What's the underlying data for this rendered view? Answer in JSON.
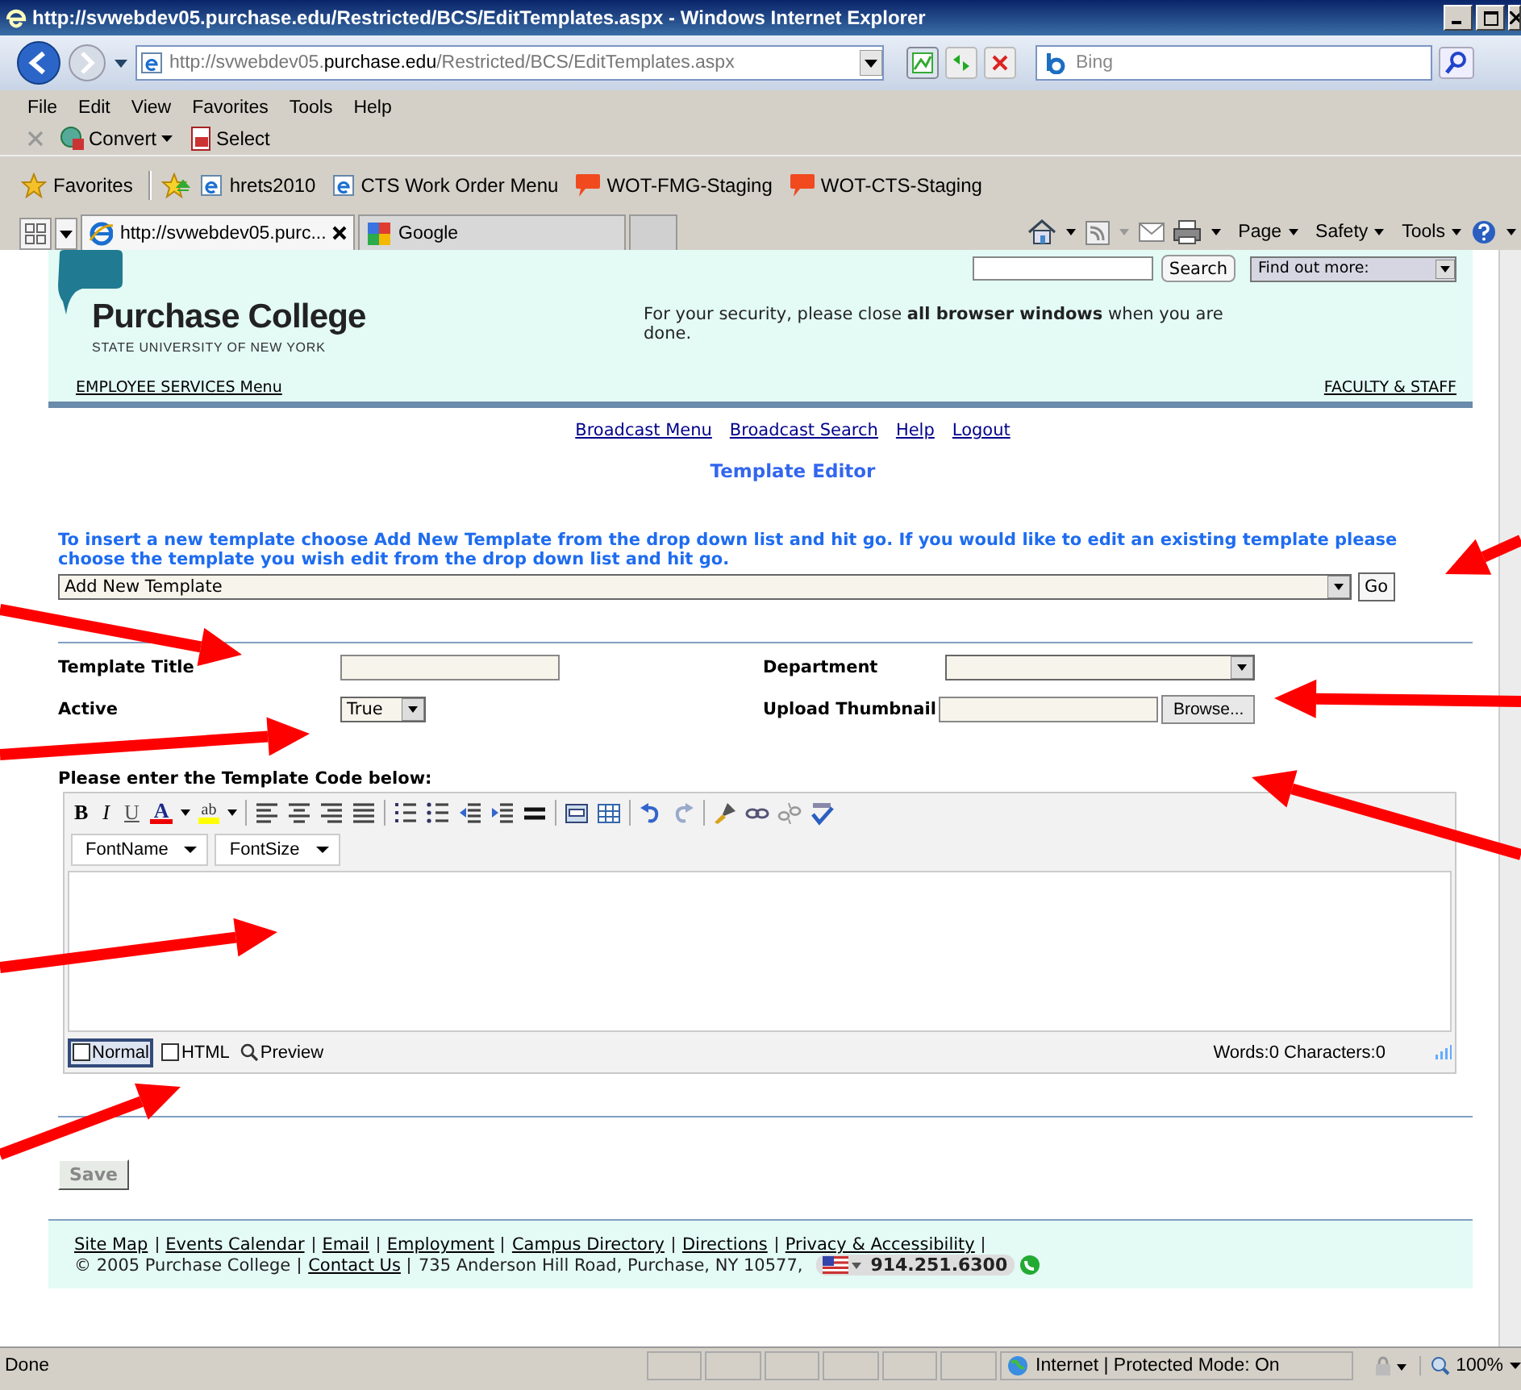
{
  "window": {
    "title": "http://svwebdev05.purchase.edu/Restricted/BCS/EditTemplates.aspx - Windows Internet Explorer"
  },
  "address_bar": {
    "url_start": "http://svwebdev05.",
    "url_domain": "purchase.edu",
    "url_end": "/Restricted/BCS/EditTemplates.aspx",
    "search_placeholder": "Bing"
  },
  "menu": [
    "File",
    "Edit",
    "View",
    "Favorites",
    "Tools",
    "Help"
  ],
  "command_bar": [
    "Convert",
    "Select"
  ],
  "favorites": {
    "label": "Favorites",
    "items": [
      {
        "label": "hrets2010",
        "kind": "page"
      },
      {
        "label": "CTS Work Order Menu",
        "kind": "page"
      },
      {
        "label": "WOT-FMG-Staging",
        "kind": "feed"
      },
      {
        "label": "WOT-CTS-Staging",
        "kind": "feed"
      }
    ]
  },
  "tabs": [
    {
      "label": "http://svwebdev05.purc...",
      "selected": true
    },
    {
      "label": "Google",
      "selected": false
    }
  ],
  "tab_tools": [
    "Page",
    "Safety",
    "Tools"
  ],
  "header": {
    "college": "Purchase College",
    "subtitle": "STATE UNIVERSITY OF NEW YORK",
    "search_button": "Search",
    "find_select": "Find out more:",
    "notice": "For your security, please close **all browser windows** when you are done.",
    "left_link": "EMPLOYEE SERVICES Menu",
    "right_link": "FACULTY & STAFF"
  },
  "nav": [
    "Broadcast Menu",
    "Broadcast Search",
    "Help",
    "Logout"
  ],
  "page_title": "Template Editor",
  "instructions": "To insert a new template choose Add New Template from the drop down list and hit go. If you would like to edit an existing template please choose the template you wish edit from the drop down list and hit go.",
  "template_select": {
    "value": "Add New Template",
    "button": "Go"
  },
  "fields": {
    "template_title": "Template Title",
    "active": "Active",
    "active_value": "True",
    "department": "Department",
    "thumbnail": "Upload Thumbnail",
    "browse": "Browse..."
  },
  "editor": {
    "label": "Please enter the Template Code below:",
    "format_buttons": [
      "B",
      "I",
      "U",
      "A",
      "ab"
    ],
    "dropdowns": [
      "FontName",
      "FontSize"
    ],
    "modes": [
      {
        "label": "Normal",
        "selected": true
      },
      {
        "label": "HTML",
        "selected": false
      },
      {
        "label": "Preview",
        "selected": false
      }
    ],
    "counts": "Words:0 Characters:0"
  },
  "save": {
    "label": "Save",
    "disabled": true
  },
  "footer": {
    "links": [
      "Site Map",
      "Events Calendar",
      "Email",
      "Employment",
      "Campus Directory",
      "Directions",
      "Privacy & Accessibility"
    ],
    "copyright": "© 2005 Purchase College",
    "contact": "Contact Us",
    "address": "735 Anderson Hill Road, Purchase, NY 10577,",
    "phone": "914.251.6300"
  },
  "status_bar": {
    "text": "Done",
    "zone": "Internet | Protected Mode: On",
    "zoom": "100%"
  }
}
